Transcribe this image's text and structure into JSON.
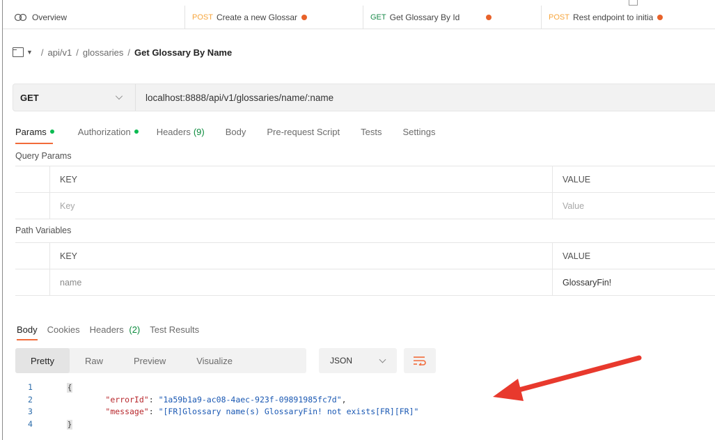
{
  "tabs": {
    "overview_label": "Overview",
    "items": [
      {
        "method": "POST",
        "title": "Create a new Glossar"
      },
      {
        "method": "GET",
        "title": "Get Glossary By Id"
      },
      {
        "method": "POST",
        "title": "Rest endpoint to initia"
      }
    ]
  },
  "breadcrumb": {
    "parts": [
      "api/v1",
      "glossaries"
    ],
    "current": "Get Glossary By Name",
    "separator": "/"
  },
  "request": {
    "method": "GET",
    "url": "localhost:8888/api/v1/glossaries/name/:name"
  },
  "request_tabs": {
    "params": "Params",
    "authorization": "Authorization",
    "headers": "Headers",
    "headers_count": "(9)",
    "body": "Body",
    "prerequest": "Pre-request Script",
    "tests": "Tests",
    "settings": "Settings"
  },
  "query_params": {
    "label": "Query Params",
    "key_header": "KEY",
    "value_header": "VALUE",
    "key_placeholder": "Key",
    "value_placeholder": "Value"
  },
  "path_variables": {
    "label": "Path Variables",
    "key_header": "KEY",
    "value_header": "VALUE",
    "rows": [
      {
        "key": "name",
        "value": "GlossaryFin!"
      }
    ]
  },
  "response_tabs": {
    "body": "Body",
    "cookies": "Cookies",
    "headers": "Headers",
    "headers_count": "(2)",
    "test_results": "Test Results"
  },
  "view_modes": [
    "Pretty",
    "Raw",
    "Preview",
    "Visualize"
  ],
  "format_select": "JSON",
  "code": {
    "line_numbers": [
      "1",
      "2",
      "3",
      "4"
    ],
    "open_brace": "{",
    "close_brace": "}",
    "fields": [
      {
        "key": "\"errorId\"",
        "value": "\"1a59b1a9-ac08-4aec-923f-09891985fc7d\"",
        "trail": ","
      },
      {
        "key": "\"message\"",
        "value": "\"[FR]Glossary name(s) GlossaryFin! not exists[FR][FR]\"",
        "trail": ""
      }
    ]
  },
  "colors": {
    "accent": "#f26b3a",
    "get_method": "#1a8a4a",
    "post_method": "#f7a53c",
    "status_dot": "#0cbb52",
    "annotation_arrow": "#e8392d"
  },
  "icons": [
    "overview-icon",
    "collection-icon",
    "chevron-down-icon",
    "wrap-lines-icon",
    "arrow-annotation"
  ]
}
